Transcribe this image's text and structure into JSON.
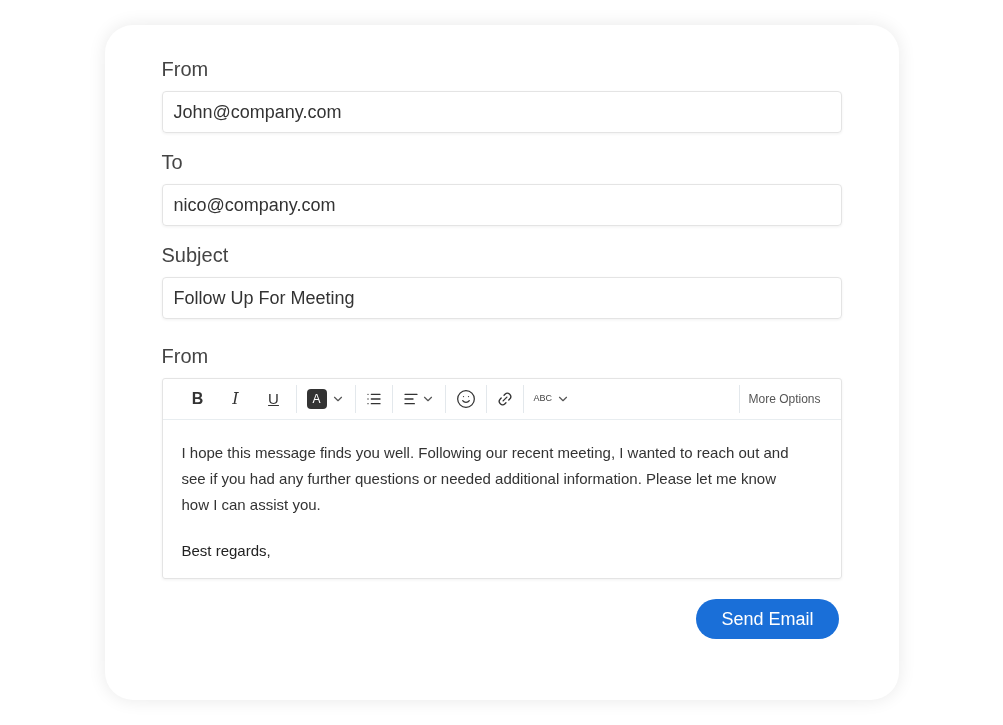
{
  "fields": [
    {
      "label": "From",
      "value": "John@company.com"
    },
    {
      "label": "To",
      "value": "nico@company.com"
    },
    {
      "label": "Subject",
      "value": "Follow Up For Meeting"
    }
  ],
  "editor": {
    "label": "From",
    "toolbar": [
      [
        {
          "kind": "bold",
          "label": "B"
        },
        {
          "kind": "italic",
          "label": "I"
        },
        {
          "kind": "underline",
          "label": "U"
        }
      ],
      [
        {
          "kind": "color",
          "label": "A"
        }
      ],
      [
        {
          "kind": "list"
        }
      ],
      [
        {
          "kind": "align"
        }
      ],
      [
        {
          "kind": "emoji"
        }
      ],
      [
        {
          "kind": "link"
        }
      ],
      [
        {
          "kind": "spell",
          "label": "ABC"
        }
      ]
    ],
    "more": "More Options",
    "paragraphs": [
      "I hope this message finds you well. Following our recent meeting, I wanted to reach out and see if you had any further questions or needed additional information. Please let me know how I can assist you.",
      "Best regards,"
    ]
  },
  "send": "Send Email"
}
